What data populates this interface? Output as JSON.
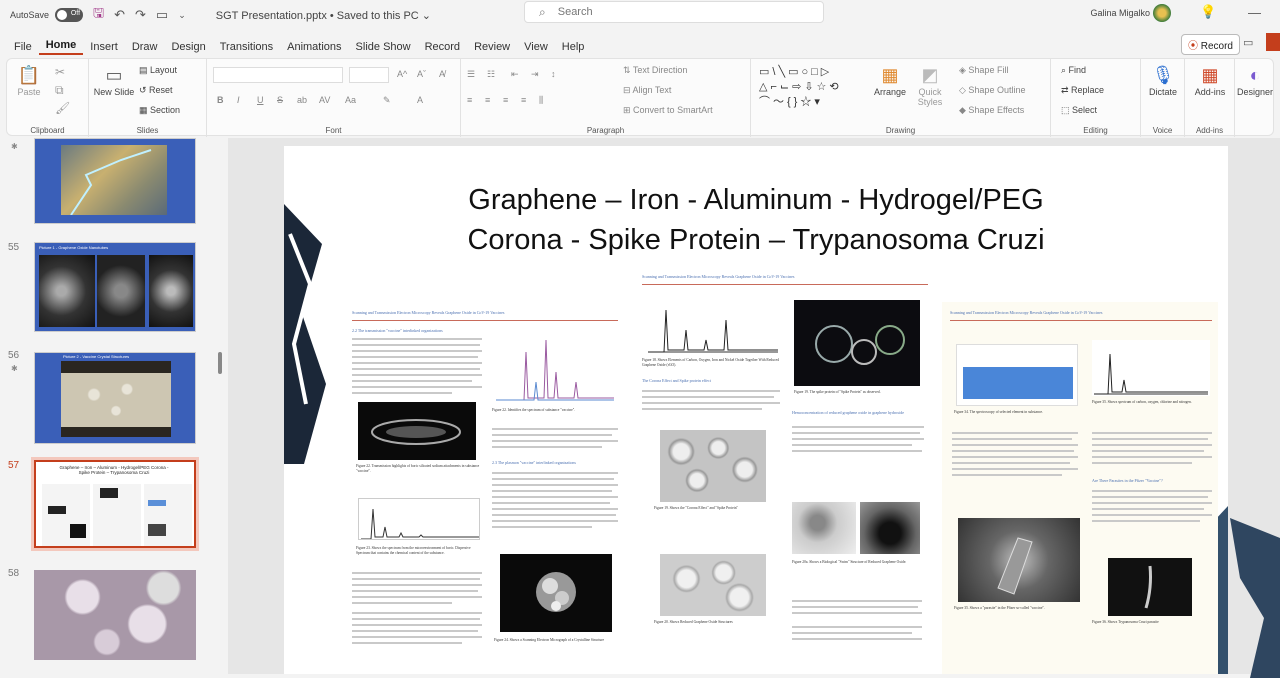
{
  "titlebar": {
    "autosave_label": "AutoSave",
    "autosave_state": "Off",
    "document_title": "SGT Presentation.pptx • Saved to this PC ⌄",
    "search_placeholder": "Search",
    "user_name": "Galina Migalko"
  },
  "menu": {
    "tabs": [
      "File",
      "Home",
      "Insert",
      "Draw",
      "Design",
      "Transitions",
      "Animations",
      "Slide Show",
      "Record",
      "Review",
      "View",
      "Help"
    ],
    "active_tab": "Home",
    "record_button": "Record"
  },
  "ribbon": {
    "clipboard": {
      "label": "Clipboard",
      "paste": "Paste"
    },
    "slides": {
      "label": "Slides",
      "new_slide": "New Slide",
      "layout": "Layout",
      "reset": "Reset",
      "section": "Section"
    },
    "font": {
      "label": "Font"
    },
    "paragraph": {
      "label": "Paragraph",
      "text_direction": "Text Direction",
      "align_text": "Align Text",
      "convert_smartart": "Convert to SmartArt"
    },
    "drawing": {
      "label": "Drawing",
      "arrange": "Arrange",
      "quick_styles": "Quick Styles",
      "shape_fill": "Shape Fill",
      "shape_outline": "Shape Outline",
      "shape_effects": "Shape Effects"
    },
    "editing": {
      "label": "Editing",
      "find": "Find",
      "replace": "Replace",
      "select": "Select"
    },
    "voice": {
      "label": "Voice",
      "dictate": "Dictate"
    },
    "addins": {
      "label": "Add-ins",
      "addins": "Add-ins"
    },
    "designer": {
      "designer": "Designer"
    }
  },
  "thumbnails": [
    {
      "number": "",
      "title": ""
    },
    {
      "number": "55",
      "title": "Picture 1 - Graphene Oxide Nanotubes"
    },
    {
      "number": "56",
      "title": "Picture 2 - Vaccine Crystal Structures"
    },
    {
      "number": "57",
      "title": "Graphene – Iron – Aluminum - Hydrogel/PEG Corona - Spike Protein – Trypanosoma Cruzi",
      "selected": true
    },
    {
      "number": "58",
      "title": ""
    }
  ],
  "slide": {
    "title_line1": "Graphene – Iron - Aluminum -  Hydrogel/PEG",
    "title_line2": "Corona  - Spike Protein – Trypanosoma Cruzi",
    "papers": [
      {
        "header": "Scanning and Transmission Electron Microscopy Reveals Graphene Oxide in CoV-19 Vaccines",
        "section1": "2.2 The transmission \"vaccine\" interlinked organizations",
        "section2": "2.3 The plasmon \"vaccine\" interlinked organizations",
        "fig_caption1": "Figure 22. Transmission highlights of boric silicated sodium attachments in substance \"vaccine\".",
        "fig_caption2": "Figure 23. Shows the spectrum from the microenvironment of boric. Dispersive Spectrum that contains the chemical content of the substance.",
        "fig_caption3": "Figure 24. Shows a Scanning Electron Micrograph of a Crystalline Structure"
      },
      {
        "header": "Scanning and Transmission Electron Microscopy Reveals Graphene Oxide in CoV-19 Vaccines",
        "subhead1": "The Corona Effect and Spike protein effect",
        "subhead2": "Hemoconcentration of reduced graphene oxide in graphene hydroxide",
        "fig_caption1": "Figure 18. Shows Elements of Carbon, Oxygen, Iron and Nickel Oxide Together With Reduced Graphene Oxide (rGO).",
        "fig_caption2": "Figure 19. Shows the \"Corona Effect\" and \"Spike Protein\"",
        "fig_caption3": "Figure 20. Shows Reduced Graphene Oxide Structures"
      },
      {
        "header": "Scanning and Transmission Electron Microscopy Reveals Graphene Oxide in CoV-19 Vaccines",
        "subhead1": "Are There Parasites in the Pfizer \"Vaccine\"?",
        "fig_caption1": "Figure 34. The spectroscopy of selected element in substance.",
        "fig_caption2": "Figure 35. Shows a \"parasite\" in the Pfizer so-called \"vaccine\".",
        "fig_caption3": "Figure 36. Shows Trypanosoma Cruzi parasite"
      }
    ]
  }
}
